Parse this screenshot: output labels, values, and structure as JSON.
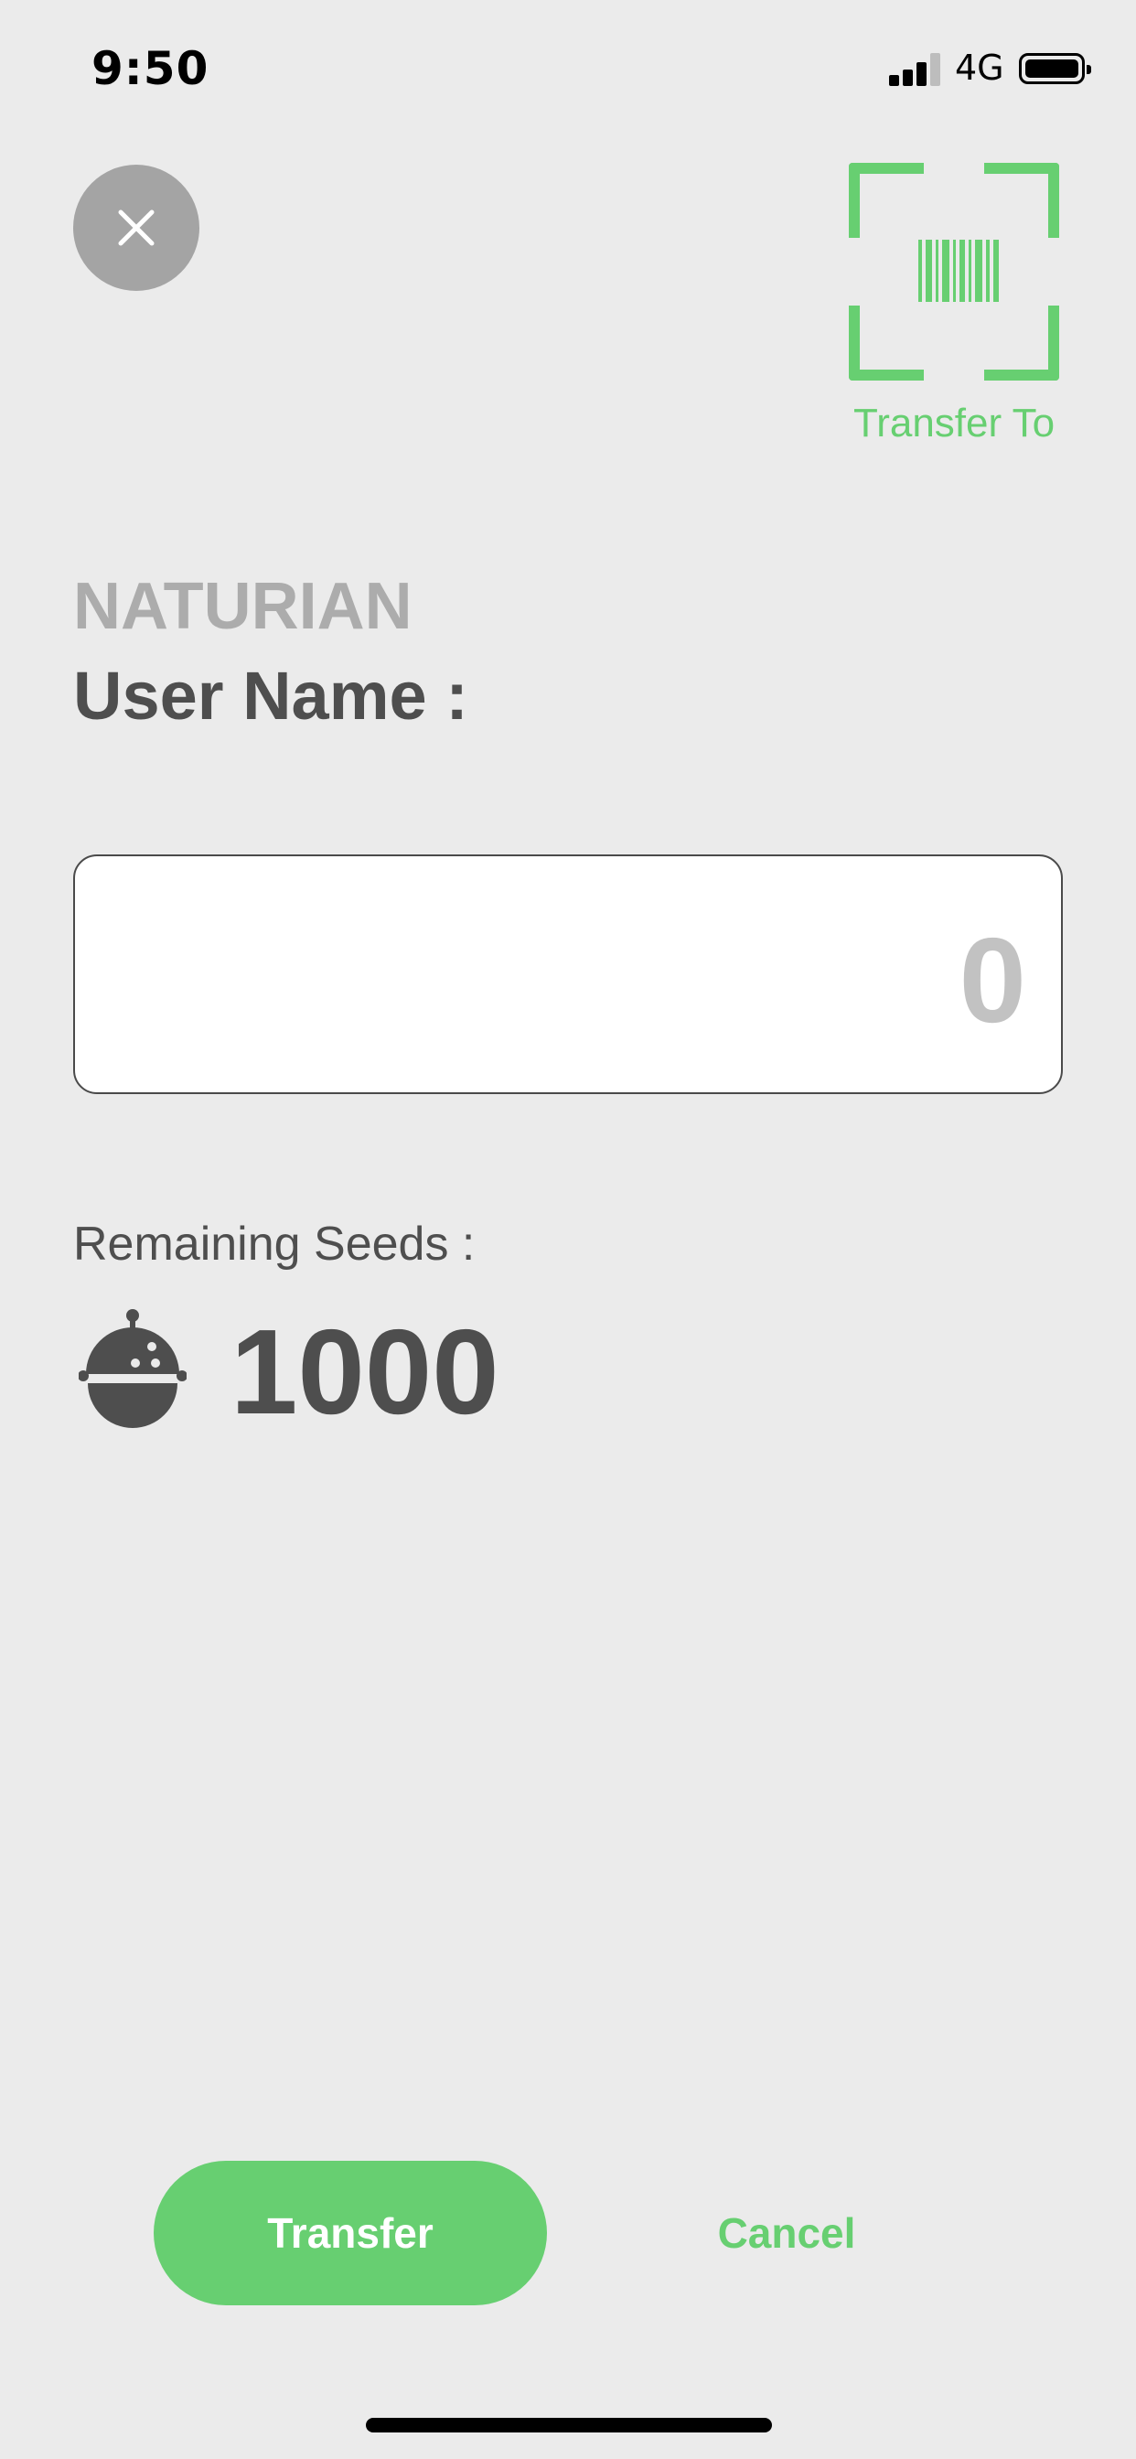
{
  "status_bar": {
    "time": "9:50",
    "network": "4G",
    "icons": [
      "signal-icon",
      "battery-icon"
    ]
  },
  "header": {
    "close_icon": "close-icon",
    "scan_icon": "barcode-scan-icon",
    "scan_label": "Transfer To"
  },
  "recipient": {
    "brand": "NATURIAN",
    "username_label": "User Name :"
  },
  "amount": {
    "value": "0"
  },
  "balance": {
    "label": "Remaining Seeds :",
    "icon": "seed-icon",
    "count": "1000"
  },
  "actions": {
    "transfer_label": "Transfer",
    "cancel_label": "Cancel"
  },
  "colors": {
    "accent": "#67cf71",
    "background": "#ebebeb",
    "text_dark": "#4e4e4e",
    "text_muted": "#acacac",
    "close_button": "#a4a4a4"
  }
}
